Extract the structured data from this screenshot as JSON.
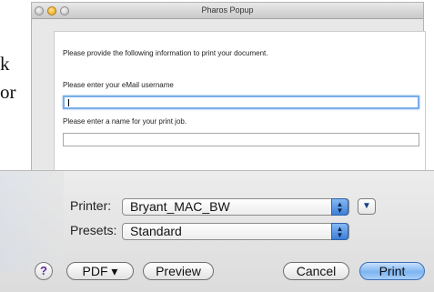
{
  "background": {
    "line1": "k",
    "line2": "or"
  },
  "popup": {
    "title": "Pharos Popup",
    "intro": "Please provide the following information to print your document.",
    "email_label": "Please enter your eMail username",
    "email_value": "",
    "jobname_label": "Please enter a name for your print job.",
    "jobname_value": ""
  },
  "print_dialog": {
    "printer_label": "Printer:",
    "printer_value": "Bryant_MAC_BW",
    "presets_label": "Presets:",
    "presets_value": "Standard",
    "help_label": "?",
    "pdf_label": "PDF ▾",
    "preview_label": "Preview",
    "cancel_label": "Cancel",
    "print_label": "Print"
  },
  "colors": {
    "accent": "#7db5f2",
    "focus_ring": "#79aee8"
  }
}
